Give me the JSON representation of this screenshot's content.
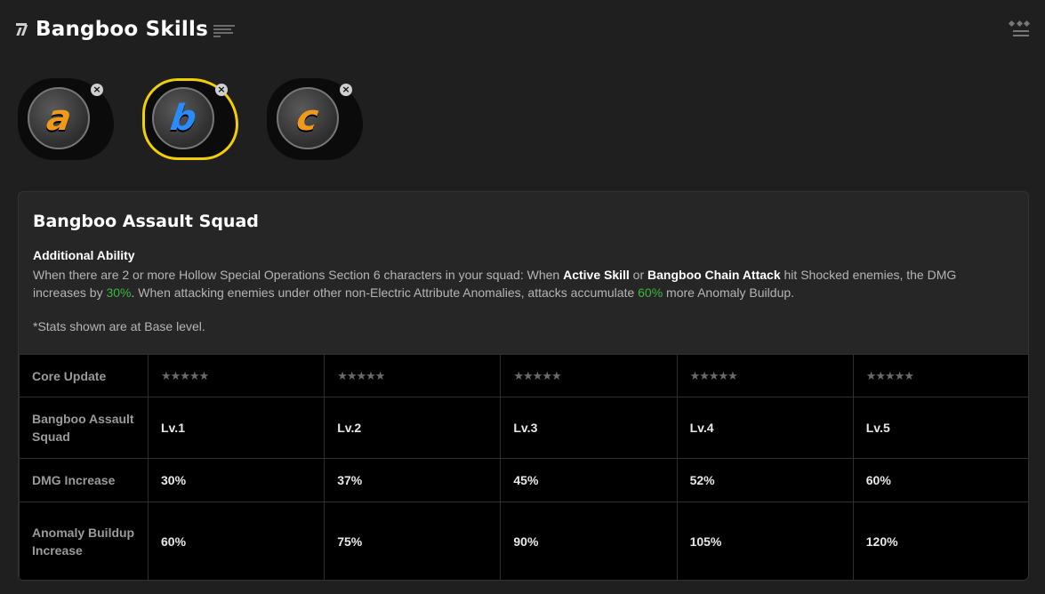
{
  "header": {
    "title": "Bangboo Skills",
    "icon": "zzz-logo-icon"
  },
  "skills": [
    {
      "letter": "a",
      "color": "#f09a1a",
      "selected": false,
      "close_icon": "close-icon"
    },
    {
      "letter": "b",
      "color": "#2a8bff",
      "selected": true,
      "close_icon": "close-icon"
    },
    {
      "letter": "c",
      "color": "#f09a1a",
      "selected": false,
      "close_icon": "close-icon"
    }
  ],
  "panel": {
    "title": "Bangboo Assault Squad",
    "ability_label": "Additional Ability",
    "desc": {
      "p1": "When there are 2 or more Hollow Special Operations Section 6 characters in your squad: When ",
      "k1": "Active Skill",
      "p2": " or ",
      "k2": "Bangboo Chain Attack",
      "p3": " hit Shocked enemies, the DMG increases by ",
      "v1": "30%",
      "p4": ". When attacking enemies under other non-Electric Attribute Anomalies, attacks accumulate ",
      "v2": "60%",
      "p5": " more Anomaly Buildup."
    },
    "stats_note": "*Stats shown are at Base level."
  },
  "table": {
    "rows": [
      {
        "label": "Core Update",
        "cells": [
          "★★★★★",
          "★★★★★",
          "★★★★★",
          "★★★★★",
          "★★★★★"
        ]
      },
      {
        "label": "Bangboo Assault Squad",
        "cells": [
          "Lv.1",
          "Lv.2",
          "Lv.3",
          "Lv.4",
          "Lv.5"
        ]
      },
      {
        "label": "DMG Increase",
        "cells": [
          "30%",
          "37%",
          "45%",
          "52%",
          "60%"
        ]
      },
      {
        "label": "Anomaly Buildup Increase",
        "cells": [
          "60%",
          "75%",
          "90%",
          "105%",
          "120%"
        ]
      }
    ]
  },
  "colors": {
    "background": "#1f1f1f",
    "accent_selected": "#f0d000",
    "highlight_green": "#3fb541"
  }
}
